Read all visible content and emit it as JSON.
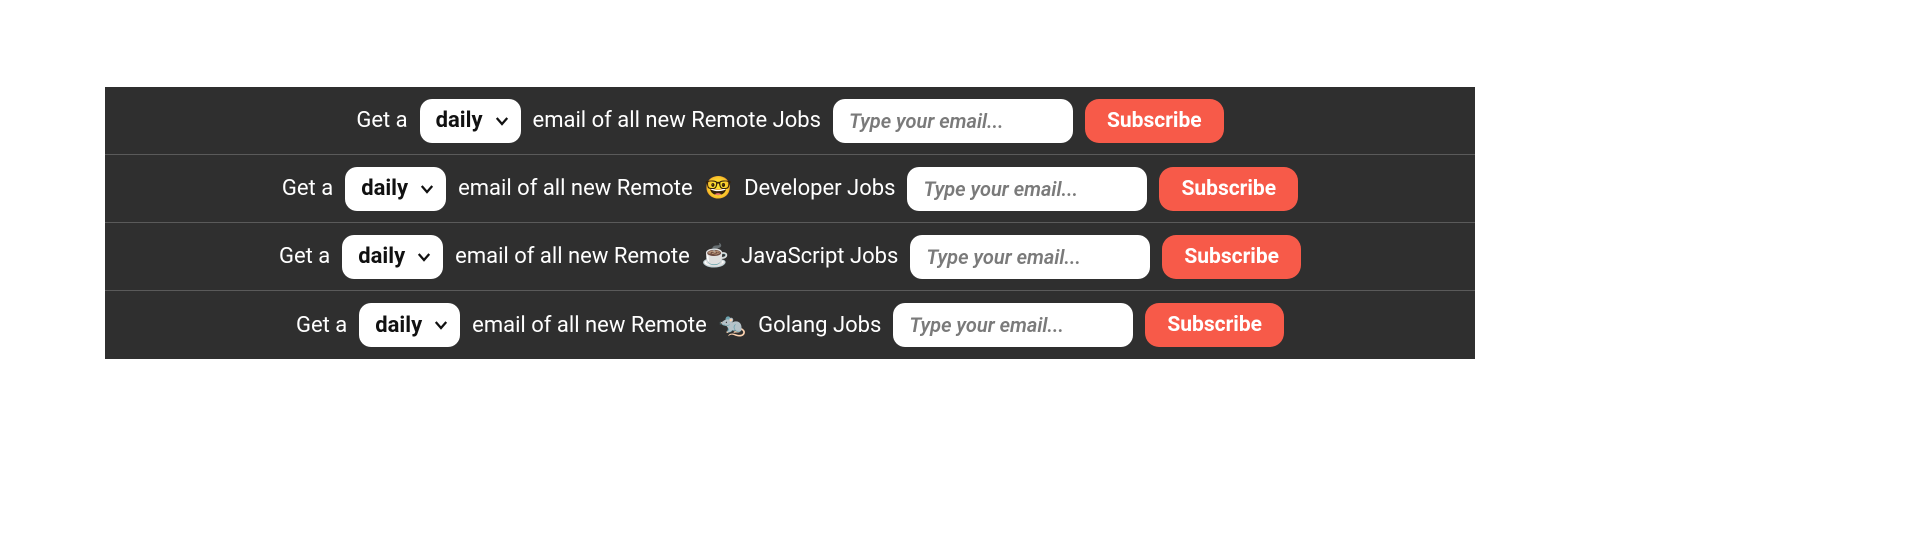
{
  "rows": [
    {
      "prefix": "Get a",
      "frequency": "daily",
      "middle": "email of all new Remote Jobs",
      "emoji": "",
      "suffix": "",
      "placeholder": "Type your email...",
      "button": "Subscribe"
    },
    {
      "prefix": "Get a",
      "frequency": "daily",
      "middle": "email of all new Remote",
      "emoji": "🤓",
      "suffix": "Developer Jobs",
      "placeholder": "Type your email...",
      "button": "Subscribe"
    },
    {
      "prefix": "Get a",
      "frequency": "daily",
      "middle": "email of all new Remote",
      "emoji": "☕",
      "suffix": "JavaScript Jobs",
      "placeholder": "Type your email...",
      "button": "Subscribe"
    },
    {
      "prefix": "Get a",
      "frequency": "daily",
      "middle": "email of all new Remote",
      "emoji": "🐀",
      "suffix": "Golang Jobs",
      "placeholder": "Type your email...",
      "button": "Subscribe"
    }
  ]
}
